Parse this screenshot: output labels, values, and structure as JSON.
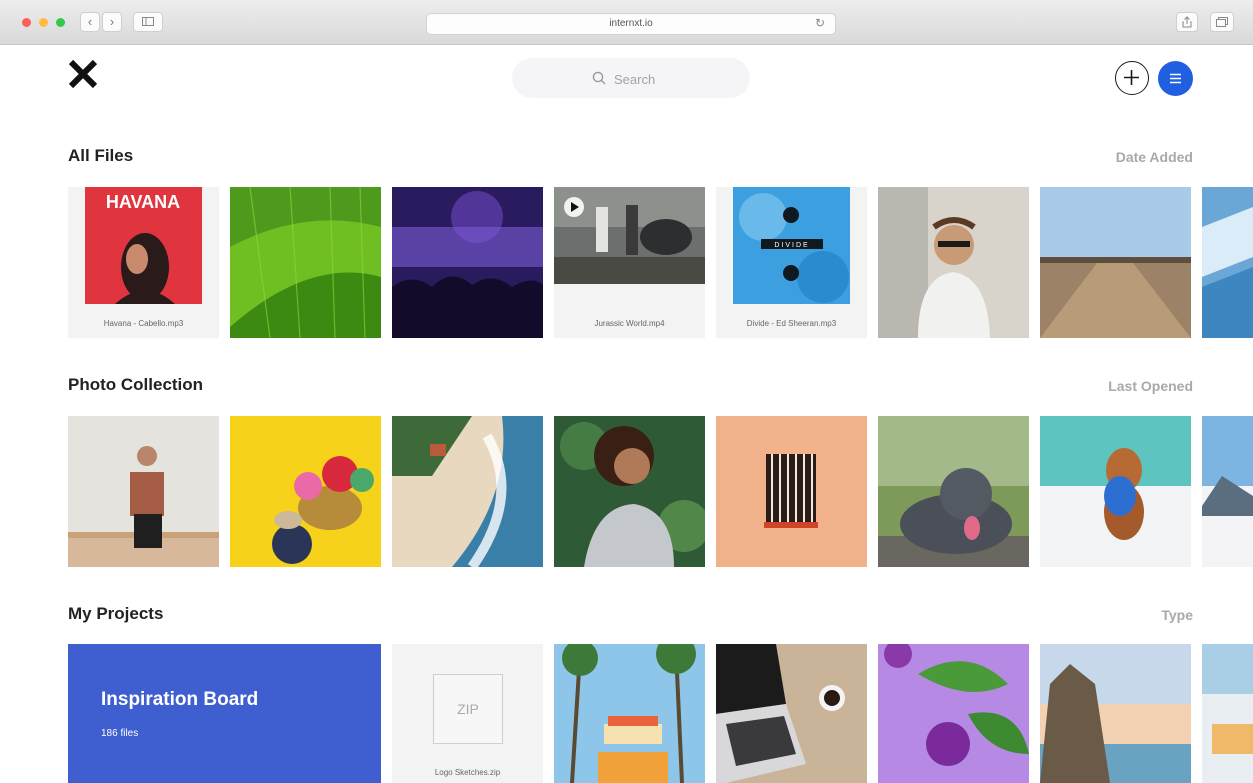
{
  "browser": {
    "url": "internxt.io"
  },
  "search": {
    "placeholder": "Search"
  },
  "sections": [
    {
      "title": "All Files",
      "sort_label": "Date Added"
    },
    {
      "title": "Photo Collection",
      "sort_label": "Last Opened"
    },
    {
      "title": "My Projects",
      "sort_label": "Type"
    }
  ],
  "all_files": {
    "havana_caption": "Havana - Cabello.mp3",
    "havana_art_text": "HAVANA",
    "jurassic_caption": "Jurassic World.mp4",
    "divide_caption": "Divide - Ed Sheeran.mp3",
    "divide_art_text": "DIVIDE"
  },
  "projects": {
    "inspiration_title": "Inspiration Board",
    "inspiration_count": "186 files",
    "zip_label": "ZIP",
    "zip_caption": "Logo Sketches.zip"
  },
  "colors": {
    "accent": "#1f5fe0",
    "board": "#3f5fd0"
  }
}
